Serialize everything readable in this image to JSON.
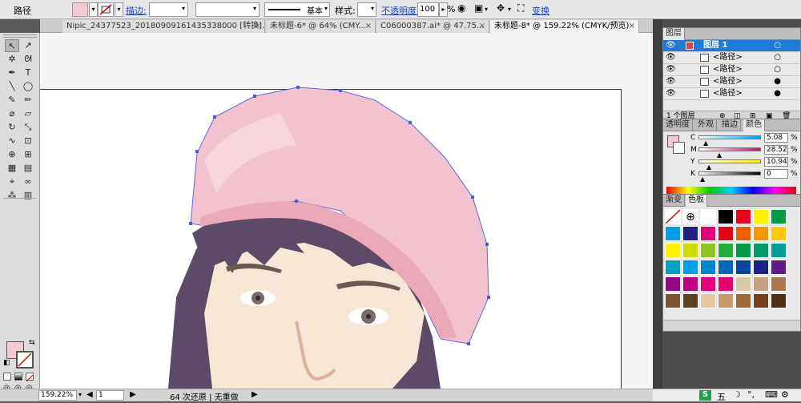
{
  "control_bar": {
    "selection_label": "路径",
    "fill_color": "#f4c9d2",
    "stroke_label": "描边:",
    "stroke_profile": "基本",
    "style_label": "样式:",
    "opacity_label": "不透明度:",
    "opacity_value": "100",
    "opacity_unit": "%",
    "transform_label": "变换"
  },
  "tabs": [
    {
      "label": "Nipic_24377523_20180909161435338000 [转换].ai*",
      "active": false
    },
    {
      "label": "未标题-6* @ 64% (CMY...",
      "active": false
    },
    {
      "label": "C06000387.ai* @ 47.75...",
      "active": false
    },
    {
      "label": "未标题-8* @ 159.22% (CMYK/预览)",
      "active": true
    }
  ],
  "tools": [
    {
      "name": "selection-tool",
      "glyph": "↖"
    },
    {
      "name": "direct-selection-tool",
      "glyph": "↗"
    },
    {
      "name": "magic-wand-tool",
      "glyph": "✲"
    },
    {
      "name": "lasso-tool",
      "glyph": "ᘛ"
    },
    {
      "name": "pen-tool",
      "glyph": "✒"
    },
    {
      "name": "type-tool",
      "glyph": "T"
    },
    {
      "name": "line-tool",
      "glyph": "╲"
    },
    {
      "name": "ellipse-tool",
      "glyph": "◯"
    },
    {
      "name": "paintbrush-tool",
      "glyph": "✎"
    },
    {
      "name": "pencil-tool",
      "glyph": "✏"
    },
    {
      "name": "blob-brush-tool",
      "glyph": "⌀"
    },
    {
      "name": "eraser-tool",
      "glyph": "▱"
    },
    {
      "name": "rotate-tool",
      "glyph": "↻"
    },
    {
      "name": "scale-tool",
      "glyph": "⤡"
    },
    {
      "name": "warp-tool",
      "glyph": "∿"
    },
    {
      "name": "free-transform-tool",
      "glyph": "⊡"
    },
    {
      "name": "shape-builder-tool",
      "glyph": "⊕"
    },
    {
      "name": "perspective-tool",
      "glyph": "⊞"
    },
    {
      "name": "mesh-tool",
      "glyph": "▦"
    },
    {
      "name": "gradient-tool",
      "glyph": "▤"
    },
    {
      "name": "eyedropper-tool",
      "glyph": "⌖"
    },
    {
      "name": "blend-tool",
      "glyph": "∞"
    },
    {
      "name": "symbol-sprayer-tool",
      "glyph": "⁂"
    },
    {
      "name": "column-graph-tool",
      "glyph": "▥"
    }
  ],
  "tool_colors": {
    "fill": "#f4c9d2",
    "stroke": "none"
  },
  "status_bar": {
    "zoom": "159.22%",
    "page": "1",
    "history": "64 次还原 | 无重做"
  },
  "layers_panel": {
    "title": "图层",
    "layer_name": "图层 1",
    "paths": [
      "<路径>",
      "<路径>",
      "<路径>",
      "<路径>"
    ],
    "footer": "1 个图层"
  },
  "color_panel": {
    "tabs": [
      "透明度",
      "外观",
      "描边",
      "颜色"
    ],
    "channels": [
      {
        "label": "C",
        "value": "5.08",
        "unit": "%",
        "level": 0.05
      },
      {
        "label": "M",
        "value": "28.52",
        "unit": "%",
        "level": 0.29
      },
      {
        "label": "Y",
        "value": "10.94",
        "unit": "%",
        "level": 0.11
      },
      {
        "label": "K",
        "value": "0",
        "unit": "%",
        "level": 0.0
      }
    ]
  },
  "swatch_panel": {
    "tabs": [
      "渐变",
      "色板"
    ],
    "swatches": [
      "#ffffff",
      "#000000",
      "#e8001c",
      "#fff100",
      "#009944",
      "#00a0e9",
      "#1d2088",
      "#e4007f",
      "#e60012",
      "#eb6100",
      "#f39800",
      "#fcc800",
      "#fff100",
      "#cfdb00",
      "#8fc31f",
      "#22ac38",
      "#009944",
      "#009b6b",
      "#009e96",
      "#00a0c1",
      "#00a0e9",
      "#0086d1",
      "#0068b7",
      "#00479d",
      "#1d2088",
      "#601986",
      "#920783",
      "#be0081",
      "#e4007f",
      "#e5006a",
      "#d8c8a8",
      "#c8a080",
      "#a87850",
      "#805030",
      "#604020",
      "#e8c8a0",
      "#c89868",
      "#a06838",
      "#784018",
      "#503010"
    ]
  },
  "tray": {
    "ime": "五"
  }
}
